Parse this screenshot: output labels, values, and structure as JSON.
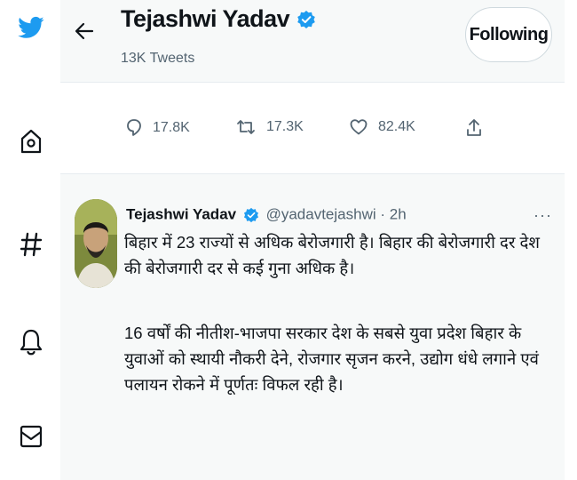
{
  "colors": {
    "accent": "#1d9bf0",
    "text": "#0f1419",
    "muted": "#536471",
    "panel": "#f7f9f9"
  },
  "nav": {
    "items": [
      {
        "icon": "twitter-bird-icon"
      },
      {
        "icon": "home-icon"
      },
      {
        "icon": "hashtag-explore-icon"
      },
      {
        "icon": "bell-notifications-icon"
      },
      {
        "icon": "envelope-messages-icon"
      }
    ]
  },
  "header": {
    "name": "Tejashwi Yadav",
    "tweet_count": "13K Tweets",
    "follow_label": "Following"
  },
  "stats": {
    "replies": "17.8K",
    "retweets": "17.3K",
    "likes": "82.4K"
  },
  "tweet": {
    "name": "Tejashwi Yadav",
    "handle": "@yadavtejashwi",
    "separator": "·",
    "time": "2h",
    "more": "···",
    "paragraph1": "बिहार में 23 राज्यों से अधिक बेरोजगारी है। बिहार की बेरोजगारी दर देश की बेरोजगारी दर से कई गुना अधिक है।",
    "paragraph2": "16 वर्षों की नीतीश-भाजपा सरकार देश के सबसे युवा प्रदेश बिहार के युवाओं को स्थायी नौकरी देने, रोजगार सृजन करने, उद्योग धंधे लगाने एवं पलायन रोकने में पूर्णतः विफल रही है।"
  }
}
